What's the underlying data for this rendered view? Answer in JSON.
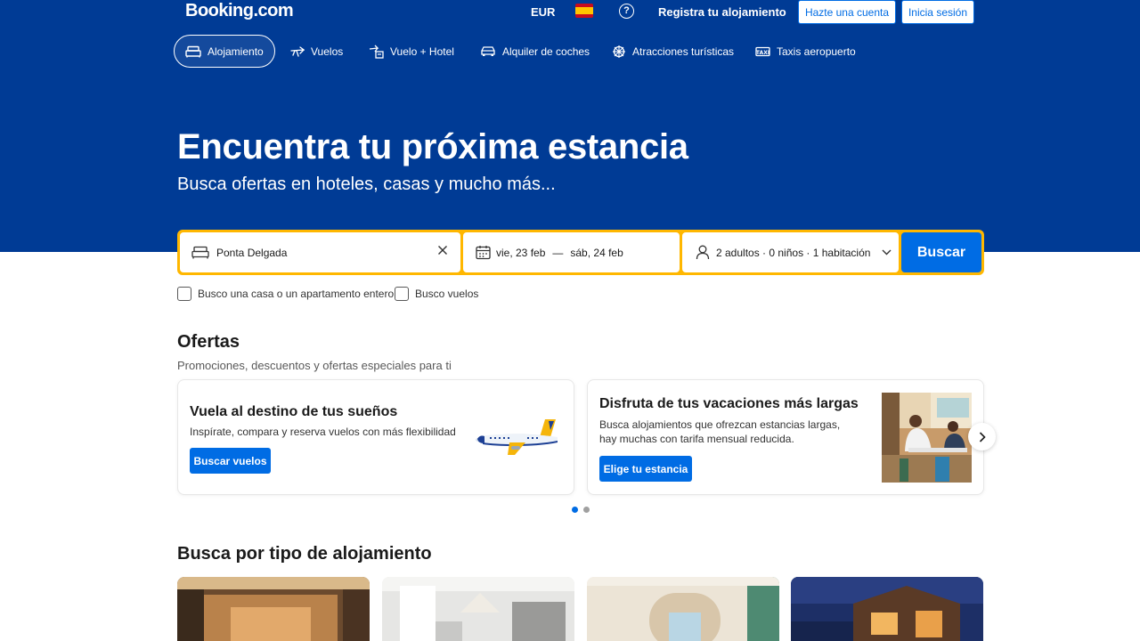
{
  "header": {
    "logo": "Booking.com",
    "currency": "EUR",
    "register_label": "Registra tu alojamiento",
    "create_account_label": "Hazte una cuenta",
    "login_label": "Inicia sesión",
    "icons": {
      "flag": "spain-flag-icon",
      "help": "help-icon"
    }
  },
  "nav": {
    "items": [
      {
        "label": "Alojamiento",
        "icon": "bed-icon",
        "active": true
      },
      {
        "label": "Vuelos",
        "icon": "plane-icon"
      },
      {
        "label": "Vuelo + Hotel",
        "icon": "plane-hotel-icon"
      },
      {
        "label": "Alquiler de coches",
        "icon": "car-icon"
      },
      {
        "label": "Atracciones turísticas",
        "icon": "attractions-icon"
      },
      {
        "label": "Taxis aeropuerto",
        "icon": "taxi-icon"
      }
    ]
  },
  "hero": {
    "title": "Encuentra tu próxima estancia",
    "subtitle": "Busca ofertas en hoteles, casas y mucho más..."
  },
  "search": {
    "destination": "Ponta Delgada",
    "date_from": "vie, 23 feb",
    "date_separator": "—",
    "date_to": "sáb, 24 feb",
    "guests": "2 adultos · 0 niños · 1 habitación",
    "button_label": "Buscar",
    "checkbox_home": "Busco una casa o un apartamento entero",
    "checkbox_flights": "Busco vuelos"
  },
  "offers": {
    "title": "Ofertas",
    "subtitle": "Promociones, descuentos y ofertas especiales para ti",
    "cards": [
      {
        "title": "Vuela al destino de tus sueños",
        "text": "Inspírate, compara y reserva vuelos con más flexibilidad",
        "button": "Buscar vuelos"
      },
      {
        "title": "Disfruta de tus vacaciones más largas",
        "text": "Busca alojamientos que ofrezcan estancias largas, hay muchas con tarifa mensual reducida.",
        "button": "Elige tu estancia"
      }
    ]
  },
  "property_types": {
    "title": "Busca por tipo de alojamiento"
  },
  "colors": {
    "brand_blue": "#003b95",
    "action_blue": "#006ce4",
    "search_border": "#ffb700"
  }
}
